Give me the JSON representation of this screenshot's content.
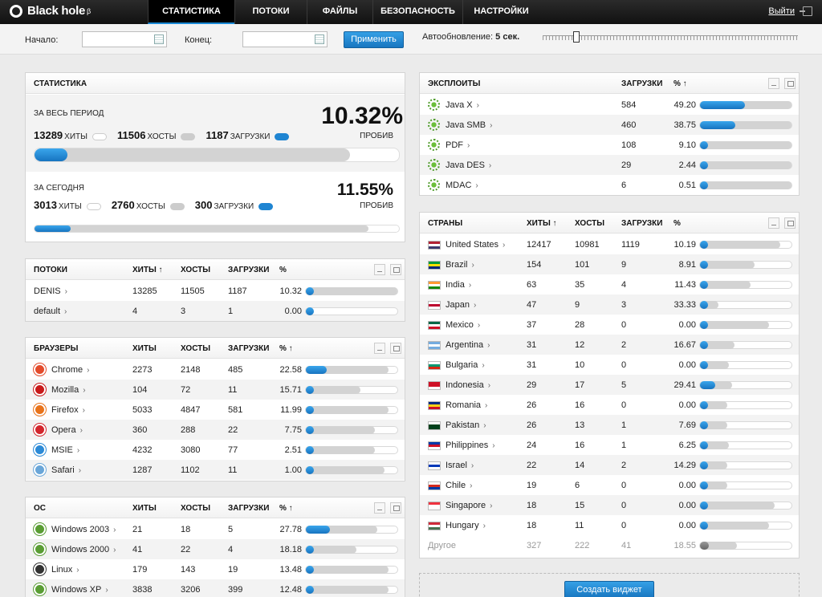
{
  "app": {
    "logo_text": "Black hole",
    "logo_sup": "β"
  },
  "nav": {
    "tabs": [
      "СТАТИСТИКА",
      "ПОТОКИ",
      "ФАЙЛЫ",
      "БЕЗОПАСНОСТЬ",
      "НАСТРОЙКИ"
    ],
    "active": "СТАТИСТИКА",
    "logout": "Выйти"
  },
  "filter": {
    "start_label": "Начало:",
    "end_label": "Конец:",
    "start_value": "",
    "end_value": "",
    "apply": "Применить",
    "autoupdate_label": "Автообновление:",
    "autoupdate_value": "5 сек."
  },
  "stats": {
    "title": "СТАТИСТИКА",
    "period": {
      "label": "ЗА ВЕСЬ ПЕРИОД",
      "hits": "13289",
      "hits_cap": "ХИТЫ",
      "hosts": "11506",
      "hosts_cap": "ХОСТЫ",
      "loads": "1187",
      "loads_cap": "ЗАГРУЗКИ",
      "percent": "10.32%",
      "percent_cap": "ПРОБИВ",
      "fill": 0.0893,
      "track": 0.866
    },
    "today": {
      "label": "ЗА СЕГОДНЯ",
      "hits": "3013",
      "hits_cap": "ХИТЫ",
      "hosts": "2760",
      "hosts_cap": "ХОСТЫ",
      "loads": "300",
      "loads_cap": "ЗАГРУЗКИ",
      "percent": "11.55%",
      "percent_cap": "ПРОБИВ",
      "fill": 0.0996,
      "track": 0.916
    }
  },
  "streams": {
    "title": "ПОТОКИ",
    "cols": [
      "ХИТЫ ↑",
      "ХОСТЫ",
      "ЗАГРУЗКИ",
      "%"
    ],
    "rows": [
      {
        "name": "DENIS",
        "hits": "13285",
        "hosts": "11505",
        "loads": "1187",
        "pct": "10.32",
        "fill": 0.02,
        "track": 1.0
      },
      {
        "name": "default",
        "hits": "4",
        "hosts": "3",
        "loads": "1",
        "pct": "0.00",
        "fill": 0,
        "track": 0
      }
    ]
  },
  "browsers": {
    "title": "БРАУЗЕРЫ",
    "cols": [
      "ХИТЫ",
      "ХОСТЫ",
      "ЗАГРУЗКИ",
      "% ↑"
    ],
    "rows": [
      {
        "name": "Chrome",
        "icon": "chrome-icon",
        "color": "#e34b2c",
        "hits": "2273",
        "hosts": "2148",
        "loads": "485",
        "pct": "22.58",
        "fill": 0.226,
        "track": 0.9
      },
      {
        "name": "Mozilla",
        "icon": "mozilla-icon",
        "color": "#c81a1a",
        "hits": "104",
        "hosts": "72",
        "loads": "11",
        "pct": "15.71",
        "fill": 0.05,
        "track": 0.6
      },
      {
        "name": "Firefox",
        "icon": "firefox-icon",
        "color": "#e8731b",
        "hits": "5033",
        "hosts": "4847",
        "loads": "581",
        "pct": "11.99",
        "fill": 0.03,
        "track": 0.9
      },
      {
        "name": "Opera",
        "icon": "opera-icon",
        "color": "#d2262c",
        "hits": "360",
        "hosts": "288",
        "loads": "22",
        "pct": "7.75",
        "fill": 0.03,
        "track": 0.75
      },
      {
        "name": "MSIE",
        "icon": "msie-icon",
        "color": "#2c8ad6",
        "hits": "4232",
        "hosts": "3080",
        "loads": "77",
        "pct": "2.51",
        "fill": 0.02,
        "track": 0.75
      },
      {
        "name": "Safari",
        "icon": "safari-icon",
        "color": "#6aa6d8",
        "hits": "1287",
        "hosts": "1102",
        "loads": "11",
        "pct": "1.00",
        "fill": 0.02,
        "track": 0.86
      }
    ]
  },
  "os": {
    "title": "ОС",
    "cols": [
      "ХИТЫ",
      "ХОСТЫ",
      "ЗАГРУЗКИ",
      "% ↑"
    ],
    "rows": [
      {
        "name": "Windows 2003",
        "icon": "windows-icon",
        "color": "#5a9d34",
        "hits": "21",
        "hosts": "18",
        "loads": "5",
        "pct": "27.78",
        "fill": 0.26,
        "track": 0.78
      },
      {
        "name": "Windows 2000",
        "icon": "windows-icon",
        "color": "#5a9d34",
        "hits": "41",
        "hosts": "22",
        "loads": "4",
        "pct": "18.18",
        "fill": 0.05,
        "track": 0.55
      },
      {
        "name": "Linux",
        "icon": "linux-icon",
        "color": "#333333",
        "hits": "179",
        "hosts": "143",
        "loads": "19",
        "pct": "13.48",
        "fill": 0.04,
        "track": 0.9
      },
      {
        "name": "Windows XP",
        "icon": "windows-icon",
        "color": "#5a9d34",
        "hits": "3838",
        "hosts": "3206",
        "loads": "399",
        "pct": "12.48",
        "fill": 0.03,
        "track": 0.9
      }
    ]
  },
  "exploits": {
    "title": "ЭКСПЛОИТЫ",
    "cols": [
      "ЗАГРУЗКИ",
      "% ↑"
    ],
    "rows": [
      {
        "name": "Java X",
        "loads": "584",
        "pct": "49.20",
        "fill": 0.49
      },
      {
        "name": "Java SMB",
        "loads": "460",
        "pct": "38.75",
        "fill": 0.39
      },
      {
        "name": "PDF",
        "loads": "108",
        "pct": "9.10",
        "fill": 0.06
      },
      {
        "name": "Java DES",
        "loads": "29",
        "pct": "2.44",
        "fill": 0.03
      },
      {
        "name": "MDAC",
        "loads": "6",
        "pct": "0.51",
        "fill": 0.02
      }
    ]
  },
  "countries": {
    "title": "СТРАНЫ",
    "cols": [
      "ХИТЫ ↑",
      "ХОСТЫ",
      "ЗАГРУЗКИ",
      "%"
    ],
    "rows": [
      {
        "name": "United States",
        "flag": [
          "#b22234",
          "#ffffff",
          "#3c3b6e"
        ],
        "hits": "12417",
        "hosts": "10981",
        "loads": "1119",
        "pct": "10.19",
        "fill": 0.03,
        "track": 0.88
      },
      {
        "name": "Brazil",
        "flag": [
          "#009b3a",
          "#fedf00",
          "#002776"
        ],
        "hits": "154",
        "hosts": "101",
        "loads": "9",
        "pct": "8.91",
        "fill": 0.03,
        "track": 0.6
      },
      {
        "name": "India",
        "flag": [
          "#ff9933",
          "#ffffff",
          "#138808"
        ],
        "hits": "63",
        "hosts": "35",
        "loads": "4",
        "pct": "11.43",
        "fill": 0.03,
        "track": 0.55
      },
      {
        "name": "Japan",
        "flag": [
          "#ffffff",
          "#bc002d",
          "#ffffff"
        ],
        "hits": "47",
        "hosts": "9",
        "loads": "3",
        "pct": "33.33",
        "fill": 0.03,
        "track": 0.2
      },
      {
        "name": "Mexico",
        "flag": [
          "#006847",
          "#ffffff",
          "#ce1126"
        ],
        "hits": "37",
        "hosts": "28",
        "loads": "0",
        "pct": "0.00",
        "fill": 0,
        "track": 0.75
      },
      {
        "name": "Argentina",
        "flag": [
          "#74acdf",
          "#ffffff",
          "#74acdf"
        ],
        "hits": "31",
        "hosts": "12",
        "loads": "2",
        "pct": "16.67",
        "fill": 0.03,
        "track": 0.38
      },
      {
        "name": "Bulgaria",
        "flag": [
          "#ffffff",
          "#00966e",
          "#d62612"
        ],
        "hits": "31",
        "hosts": "10",
        "loads": "0",
        "pct": "0.00",
        "fill": 0,
        "track": 0.32
      },
      {
        "name": "Indonesia",
        "flag": [
          "#ce1126",
          "#ce1126",
          "#ffffff"
        ],
        "hits": "29",
        "hosts": "17",
        "loads": "5",
        "pct": "29.41",
        "fill": 0.17,
        "track": 0.35
      },
      {
        "name": "Romania",
        "flag": [
          "#002b7f",
          "#fcd116",
          "#ce1126"
        ],
        "hits": "26",
        "hosts": "16",
        "loads": "0",
        "pct": "0.00",
        "fill": 0,
        "track": 0.3
      },
      {
        "name": "Pakistan",
        "flag": [
          "#ffffff",
          "#01411c",
          "#01411c"
        ],
        "hits": "26",
        "hosts": "13",
        "loads": "1",
        "pct": "7.69",
        "fill": 0.03,
        "track": 0.3
      },
      {
        "name": "Philippines",
        "flag": [
          "#0038a8",
          "#ce1126",
          "#ffffff"
        ],
        "hits": "24",
        "hosts": "16",
        "loads": "1",
        "pct": "6.25",
        "fill": 0.03,
        "track": 0.32
      },
      {
        "name": "Israel",
        "flag": [
          "#ffffff",
          "#0038b8",
          "#ffffff"
        ],
        "hits": "22",
        "hosts": "14",
        "loads": "2",
        "pct": "14.29",
        "fill": 0.03,
        "track": 0.3
      },
      {
        "name": "Chile",
        "flag": [
          "#ffffff",
          "#d52b1e",
          "#0039a6"
        ],
        "hits": "19",
        "hosts": "6",
        "loads": "0",
        "pct": "0.00",
        "fill": 0,
        "track": 0.3
      },
      {
        "name": "Singapore",
        "flag": [
          "#ef3340",
          "#ffffff",
          "#ffffff"
        ],
        "hits": "18",
        "hosts": "15",
        "loads": "0",
        "pct": "0.00",
        "fill": 0,
        "track": 0.82
      },
      {
        "name": "Hungary",
        "flag": [
          "#ce2939",
          "#ffffff",
          "#477050"
        ],
        "hits": "18",
        "hosts": "11",
        "loads": "0",
        "pct": "0.00",
        "fill": 0,
        "track": 0.75
      }
    ],
    "other": {
      "name": "Другое",
      "hits": "327",
      "hosts": "222",
      "loads": "41",
      "pct": "18.55",
      "fill": 0.1,
      "track": 0.4
    }
  },
  "create_widget": "Создать виджет"
}
